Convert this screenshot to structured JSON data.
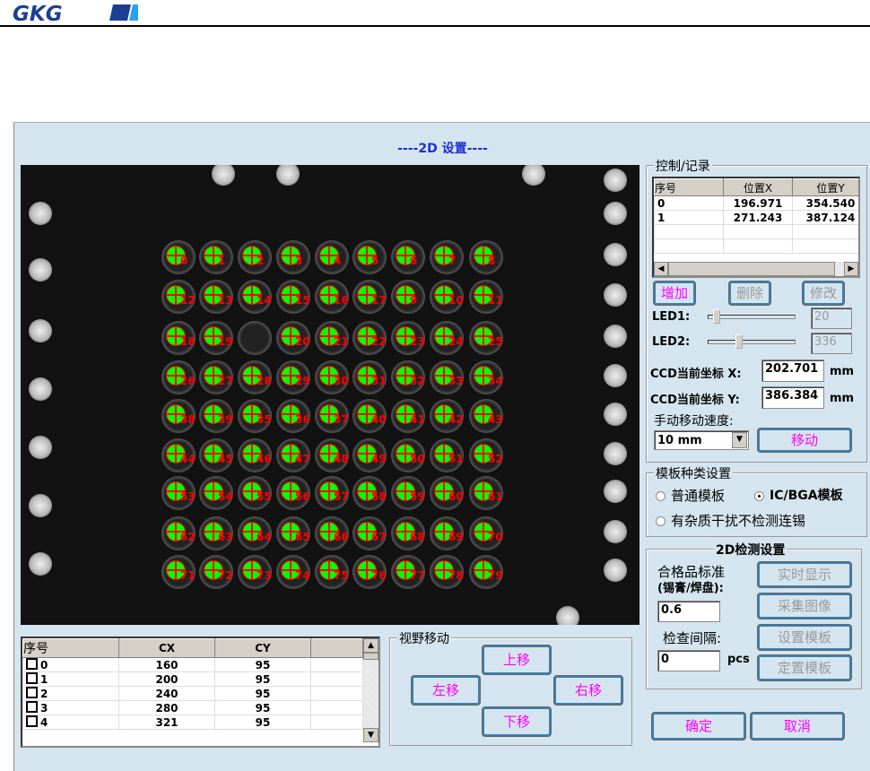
{
  "header": {
    "logo_text": "GKG"
  },
  "window": {
    "title": "----2D 设置----"
  },
  "camera": {
    "pad_labels": [
      [
        "0",
        "1",
        "2",
        "3",
        "4",
        "5",
        "6",
        "7",
        "8"
      ],
      [
        "12",
        "13",
        "14",
        "15",
        "16",
        "17",
        "9",
        "10",
        "11"
      ],
      [
        "18",
        "19",
        null,
        "20",
        "21",
        "22",
        "23",
        "24",
        "25"
      ],
      [
        "26",
        "27",
        "28",
        "29",
        "30",
        "31",
        "32",
        "33",
        "34"
      ],
      [
        "38",
        "39",
        "35",
        "36",
        "37",
        "40",
        "41",
        "42",
        "43"
      ],
      [
        "44",
        "45",
        "46",
        "47",
        "48",
        "49",
        "50",
        "51",
        "52"
      ],
      [
        "53",
        "54",
        "55",
        "56",
        "57",
        "58",
        "59",
        "60",
        "61"
      ],
      [
        "62",
        "63",
        "64",
        "65",
        "66",
        "67",
        "68",
        "69",
        "70"
      ],
      [
        "71",
        "72",
        "73",
        "74",
        "75",
        "76",
        "77",
        "78",
        "79"
      ]
    ],
    "colors": {
      "pad_fill": "#00ff00",
      "cross": "#ff0000",
      "label": "#ff0000"
    }
  },
  "control_record": {
    "title": "控制/记录",
    "columns": [
      "序号",
      "位置X",
      "位置Y"
    ],
    "rows": [
      [
        "0",
        "196.971",
        "354.540"
      ],
      [
        "1",
        "271.243",
        "387.124"
      ]
    ],
    "add": "增加",
    "delete": "删除",
    "modify": "修改",
    "led1_label": "LED1:",
    "led1_value": "20",
    "led1_fraction": 0.06,
    "led2_label": "LED2:",
    "led2_value": "336",
    "led2_fraction": 0.33,
    "ccd_x_label": "CCD当前坐标 X:",
    "ccd_x": "202.701",
    "ccd_y_label": "CCD当前坐标 Y:",
    "ccd_y": "386.384",
    "unit": "mm",
    "speed_label": "手动移动速度:",
    "speed_value": "10 mm",
    "move": "移动"
  },
  "template_type": {
    "title": "模板种类设置",
    "options": [
      {
        "label": "普通模板",
        "checked": false
      },
      {
        "label": "IC/BGA模板",
        "checked": true
      },
      {
        "label": "有杂质干扰不检测连锡",
        "checked": false
      }
    ]
  },
  "detect": {
    "title": "2D检测设置",
    "standard_label1": "合格品标准",
    "standard_label2": "(锡膏/焊盘):",
    "standard_value": "0.6",
    "interval_label": "检查间隔:",
    "interval_value": "0",
    "interval_unit": "pcs",
    "realtime": "实时显示",
    "capture": "采集图像",
    "set_template": "设置模板",
    "locate_template": "定置模板"
  },
  "ok": "确定",
  "cancel": "取消",
  "pad_table": {
    "columns": [
      "序号",
      "CX",
      "CY",
      ""
    ],
    "rows": [
      [
        "0",
        "160",
        "95"
      ],
      [
        "1",
        "200",
        "95"
      ],
      [
        "2",
        "240",
        "95"
      ],
      [
        "3",
        "280",
        "95"
      ],
      [
        "4",
        "321",
        "95"
      ]
    ]
  },
  "view_move": {
    "title": "视野移动",
    "up": "上移",
    "left": "左移",
    "right": "右移",
    "down": "下移"
  }
}
